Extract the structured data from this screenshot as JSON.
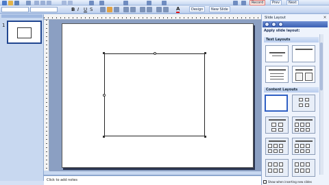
{
  "toolbar": {
    "design_label": "Design",
    "new_slide_label": "New Slide",
    "font_color_label": "A",
    "format": {
      "bold": "B",
      "italic": "I",
      "underline": "U",
      "shadow": "S"
    },
    "record_label": "Record",
    "prev_label": "Prev",
    "next_label": "Next"
  },
  "slides_pane": {
    "slide_number": "1"
  },
  "notes": {
    "placeholder": "Click to add notes"
  },
  "task_pane": {
    "title": "Slide Layout",
    "close": "×",
    "apply_label": "Apply slide layout:",
    "sections": [
      "Text Layouts",
      "Content Layouts"
    ],
    "footer_checkbox_label": "Show when inserting new slides"
  },
  "colors": {
    "accent": "#2f5fc4",
    "workspace": "#8b9fc2",
    "toolbar": "#c6d7f1"
  }
}
